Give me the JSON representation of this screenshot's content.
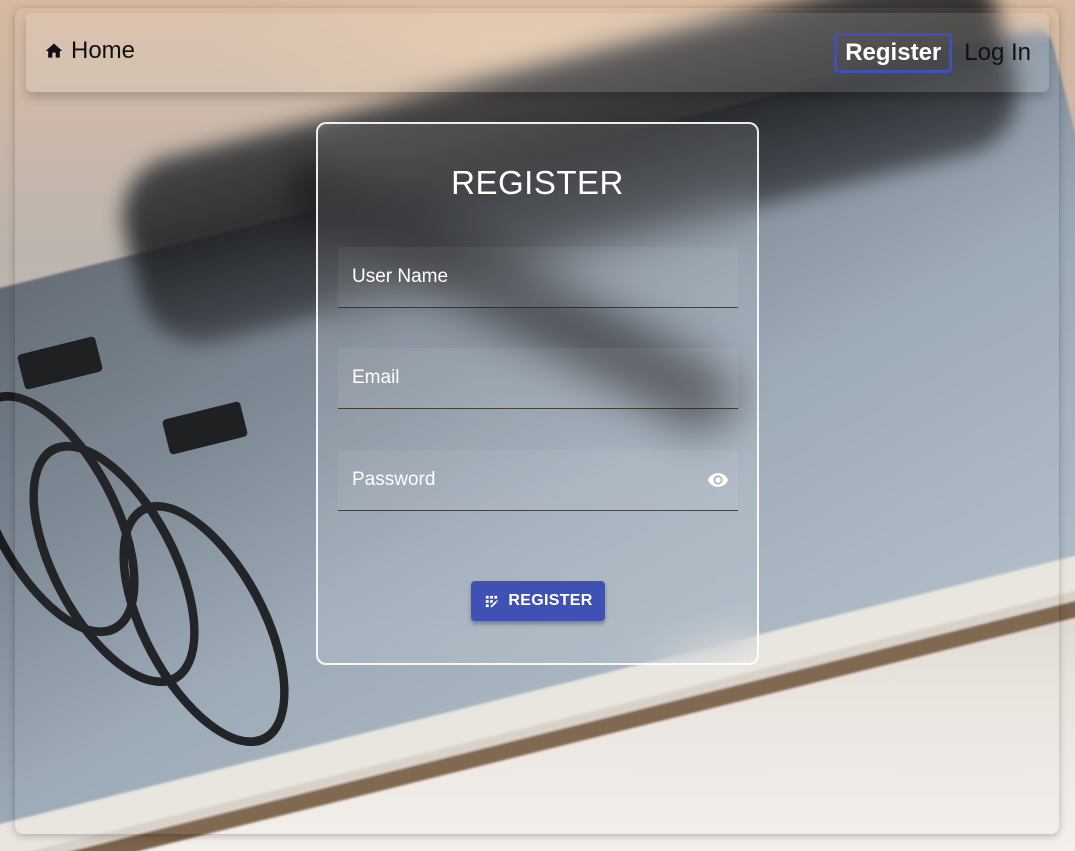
{
  "nav": {
    "home_label": "Home",
    "home_icon": "home-icon",
    "register_label": "Register",
    "login_label": "Log In"
  },
  "form": {
    "title": "REGISTER",
    "username": {
      "placeholder": "User Name",
      "value": ""
    },
    "email": {
      "placeholder": "Email",
      "value": ""
    },
    "password": {
      "placeholder": "Password",
      "value": "",
      "toggle_icon": "eye-icon"
    },
    "submit_label": "REGISTER",
    "submit_icon": "app-registration-icon"
  },
  "colors": {
    "accent": "#3f51b5",
    "card_border": "#ffffff"
  }
}
